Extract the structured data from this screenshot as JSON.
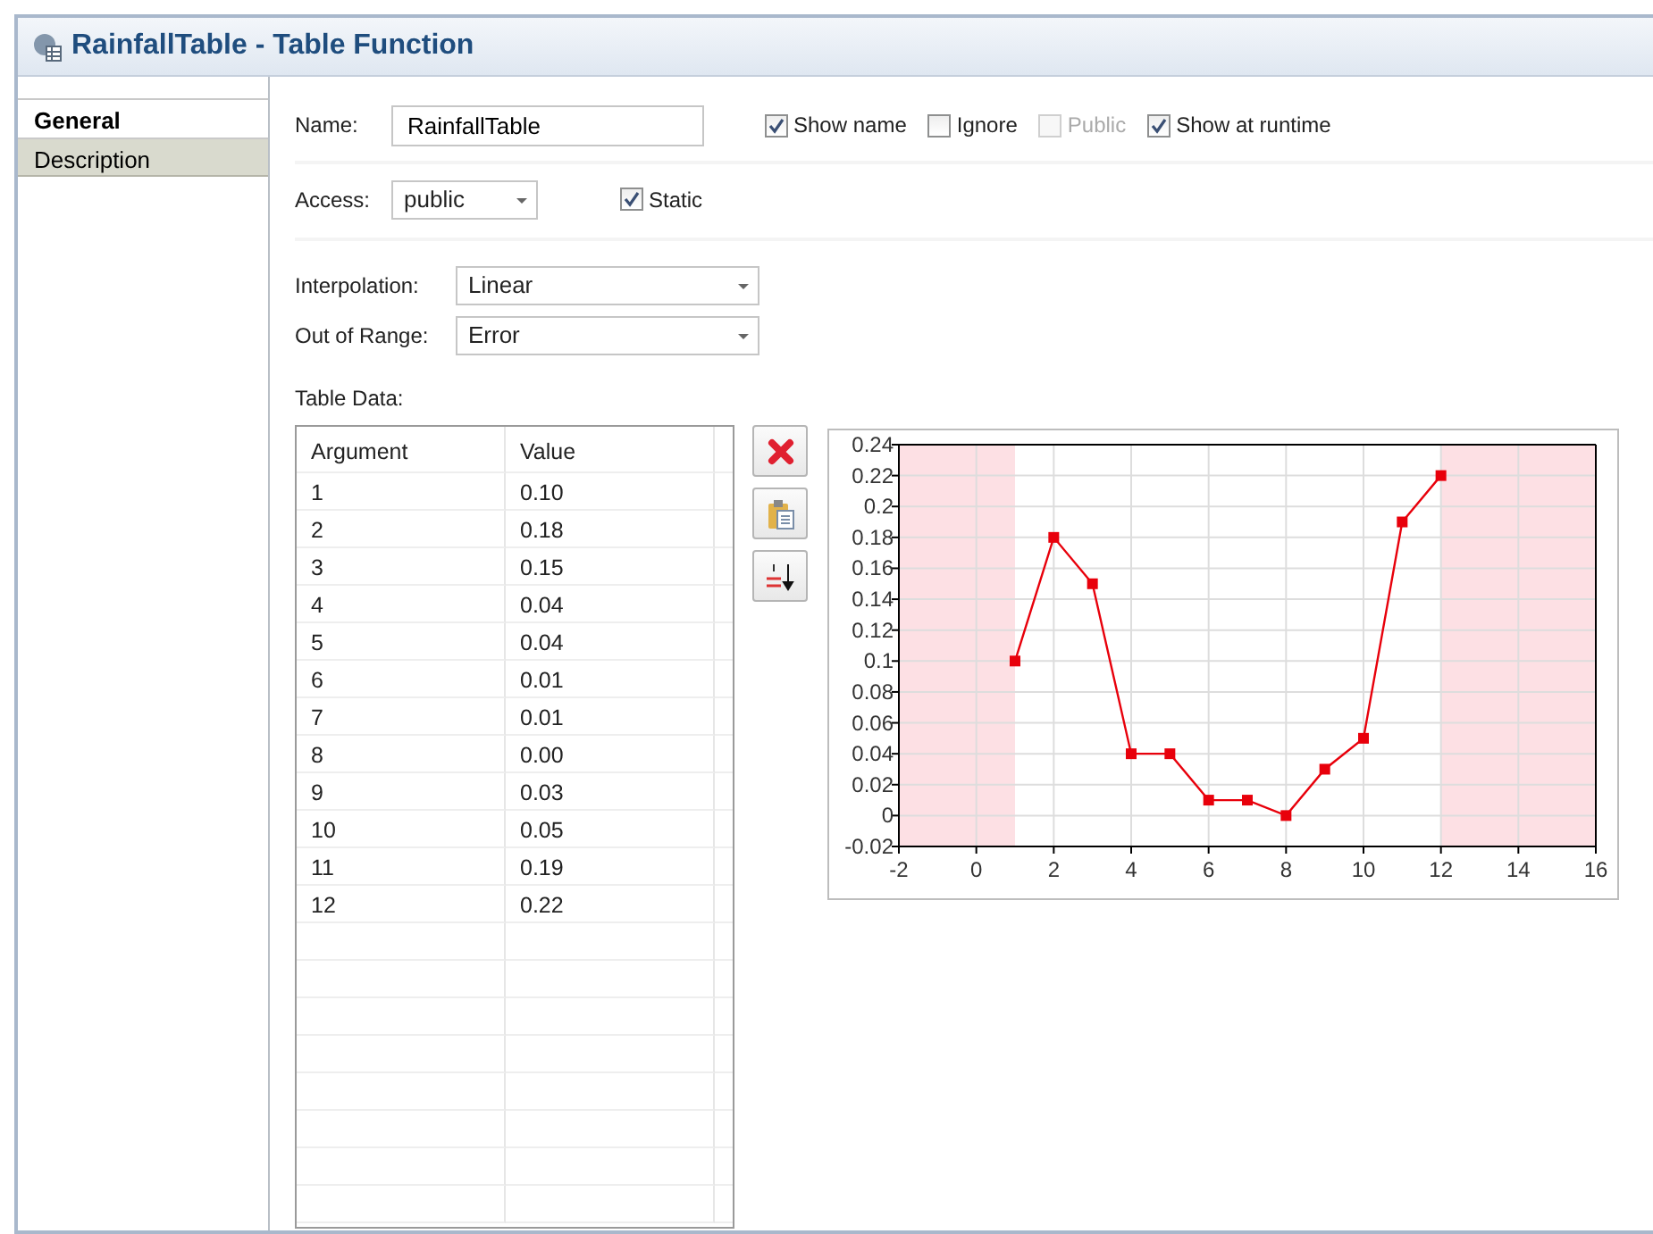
{
  "window": {
    "title": "RainfallTable - Table Function"
  },
  "tabs": [
    {
      "label": "General",
      "selected": true
    },
    {
      "label": "Description",
      "selected": false
    }
  ],
  "name_field": {
    "label": "Name:",
    "value": "RainfallTable"
  },
  "options": [
    {
      "label": "Show name",
      "checked": true,
      "disabled": false
    },
    {
      "label": "Ignore",
      "checked": false,
      "disabled": false
    },
    {
      "label": "Public",
      "checked": false,
      "disabled": true
    },
    {
      "label": "Show at runtime",
      "checked": true,
      "disabled": false
    }
  ],
  "access": {
    "label": "Access:",
    "value": "public"
  },
  "static_option": {
    "label": "Static",
    "checked": true,
    "disabled": false
  },
  "interpolation": {
    "label": "Interpolation:",
    "value": "Linear"
  },
  "out_of_range": {
    "label": "Out of Range:",
    "value": "Error"
  },
  "table": {
    "title": "Table Data:",
    "columns": [
      "Argument",
      "Value"
    ],
    "rows": [
      [
        "1",
        "0.10"
      ],
      [
        "2",
        "0.18"
      ],
      [
        "3",
        "0.15"
      ],
      [
        "4",
        "0.04"
      ],
      [
        "5",
        "0.04"
      ],
      [
        "6",
        "0.01"
      ],
      [
        "7",
        "0.01"
      ],
      [
        "8",
        "0.00"
      ],
      [
        "9",
        "0.03"
      ],
      [
        "10",
        "0.05"
      ],
      [
        "11",
        "0.19"
      ],
      [
        "12",
        "0.22"
      ]
    ]
  },
  "chart_data": {
    "type": "line",
    "x": [
      1,
      2,
      3,
      4,
      5,
      6,
      7,
      8,
      9,
      10,
      11,
      12
    ],
    "grid": true,
    "series": [
      {
        "color": "#e8000b",
        "marker": "square",
        "values": [
          0.1,
          0.18,
          0.15,
          0.04,
          0.04,
          0.01,
          0.01,
          0.0,
          0.03,
          0.05,
          0.19,
          0.22
        ]
      }
    ],
    "xlim": [
      -2,
      16
    ],
    "ylim": [
      -0.02,
      0.24
    ],
    "xticks": [
      -2,
      0,
      2,
      4,
      6,
      8,
      10,
      12,
      14,
      16
    ],
    "yticks": [
      {
        "value": -0.02,
        "label": "-0.02"
      },
      {
        "value": 0,
        "label": "0"
      },
      {
        "value": 0.02,
        "label": "0.02"
      },
      {
        "value": 0.04,
        "label": "0.04"
      },
      {
        "value": 0.06,
        "label": "0.06"
      },
      {
        "value": 0.08,
        "label": "0.08"
      },
      {
        "value": 0.1,
        "label": "0.1"
      },
      {
        "value": 0.12,
        "label": "0.12"
      },
      {
        "value": 0.14,
        "label": "0.14"
      },
      {
        "value": 0.16,
        "label": "0.16"
      },
      {
        "value": 0.18,
        "label": "0.18"
      },
      {
        "value": 0.2,
        "label": "0.2"
      },
      {
        "value": 0.22,
        "label": "0.22"
      },
      {
        "value": 0.24,
        "label": "0.24"
      }
    ]
  }
}
